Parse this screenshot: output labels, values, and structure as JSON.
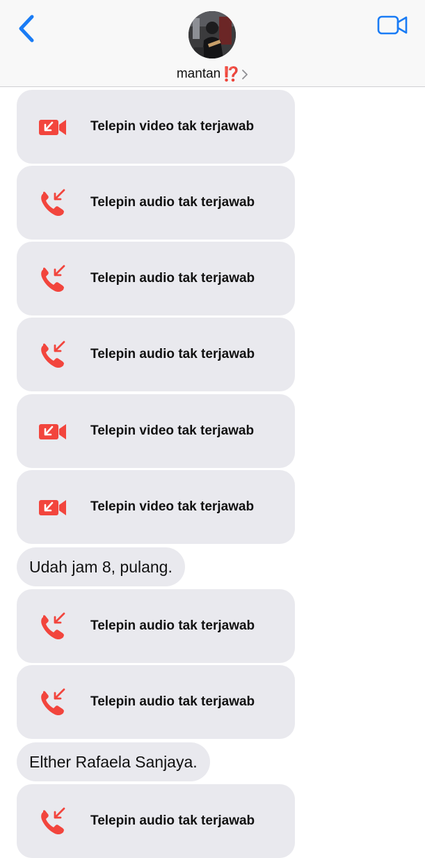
{
  "header": {
    "contact_name": "mantan",
    "contact_emoji": "⁉️",
    "back_icon": "chevron-left-icon",
    "video_icon": "video-camera-icon",
    "accent_color": "#1a7cf5"
  },
  "messages": [
    {
      "kind": "call",
      "call_type": "video",
      "label": "Telepin video tak terjawab"
    },
    {
      "kind": "call",
      "call_type": "audio",
      "label": "Telepin audio tak terjawab"
    },
    {
      "kind": "call",
      "call_type": "audio",
      "label": "Telepin audio tak terjawab"
    },
    {
      "kind": "call",
      "call_type": "audio",
      "label": "Telepin audio tak terjawab"
    },
    {
      "kind": "call",
      "call_type": "video",
      "label": "Telepin video tak terjawab"
    },
    {
      "kind": "call",
      "call_type": "video",
      "label": "Telepin video tak terjawab"
    },
    {
      "kind": "text",
      "label": "Udah jam 8, pulang."
    },
    {
      "kind": "call",
      "call_type": "audio",
      "label": "Telepin audio tak terjawab"
    },
    {
      "kind": "call",
      "call_type": "audio",
      "label": "Telepin audio tak terjawab"
    },
    {
      "kind": "text",
      "label": "Elther Rafaela Sanjaya."
    },
    {
      "kind": "call",
      "call_type": "audio",
      "label": "Telepin audio tak terjawab"
    }
  ],
  "colors": {
    "missed_call_red": "#f2453d",
    "bubble_gray": "#e9e9ee"
  }
}
